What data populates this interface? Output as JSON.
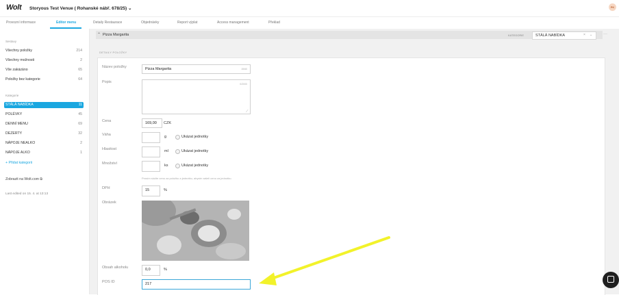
{
  "header": {
    "logo": "Wolt",
    "venue_title": "Storyous Test Venue ( Rohanské nábř. 678/25) ⌄",
    "avatar_initials": "PK"
  },
  "tabs": [
    {
      "label": "Provozní informace"
    },
    {
      "label": "Editor menu",
      "active": true
    },
    {
      "label": "Detaily Restaurace"
    },
    {
      "label": "Objednávky"
    },
    {
      "label": "Report výplat"
    },
    {
      "label": "Access management"
    },
    {
      "label": "Překlad"
    }
  ],
  "sidebar": {
    "sets_heading": "Sestavy",
    "sets": [
      {
        "label": "Všechny položky",
        "count": "214"
      },
      {
        "label": "Všechny možnosti",
        "count": "2"
      },
      {
        "label": "Vše zakázáno",
        "count": "65"
      },
      {
        "label": "Položky bez kategorie",
        "count": "64"
      }
    ],
    "categories_heading": "Kategorie",
    "categories": [
      {
        "label": "STÁLÁ NABÍDKA",
        "count": "11",
        "selected": true
      },
      {
        "label": "POLÉVKY",
        "count": "45"
      },
      {
        "label": "DENNÍ MENU",
        "count": "69"
      },
      {
        "label": "DEZERTY",
        "count": "32"
      },
      {
        "label": "NÁPOJE NEALKO",
        "count": "2"
      },
      {
        "label": "NÁPOJE ALKO",
        "count": "1"
      }
    ],
    "add_category": "+ Přidat kategorii",
    "view_on_wolt": "Zobrazit na Wolt.com",
    "last_edited": "Last edited on 15. 4. at 13:13"
  },
  "item": {
    "title": "Pizza Margarita",
    "category_label": "KATEGORIE",
    "category_value": "STÁLÁ NABÍDKA",
    "section_title": "DETAILY POLOŽKY",
    "fields": {
      "name_label": "Název položky",
      "name_value": "Pizza Margarita",
      "name_counter": "15/60",
      "description_label": "Popis",
      "description_counter": "0/2000",
      "price_label": "Cena",
      "price_value": "169,00",
      "price_currency": "CZK",
      "weight_label": "Váha",
      "weight_unit": "g",
      "volume_label": "Hlasitost",
      "volume_unit": "ml",
      "quantity_label": "Množství",
      "quantity_unit": "ks",
      "show_units": "Ukázat jednotky",
      "unit_hint": "Prosím složte cenu za položku a jednotku, abyste vašeli cenu za jednotku.",
      "vat_label": "DPH",
      "vat_value": "15",
      "vat_unit": "%",
      "image_label": "Obrázek",
      "alcohol_label": "Obsah alkoholu",
      "alcohol_value": "0,0",
      "alcohol_unit": "%",
      "pos_label": "POS ID",
      "pos_value": "217"
    }
  },
  "colors": {
    "accent": "#1aa7e0",
    "annotation_arrow": "#f2f22a"
  }
}
